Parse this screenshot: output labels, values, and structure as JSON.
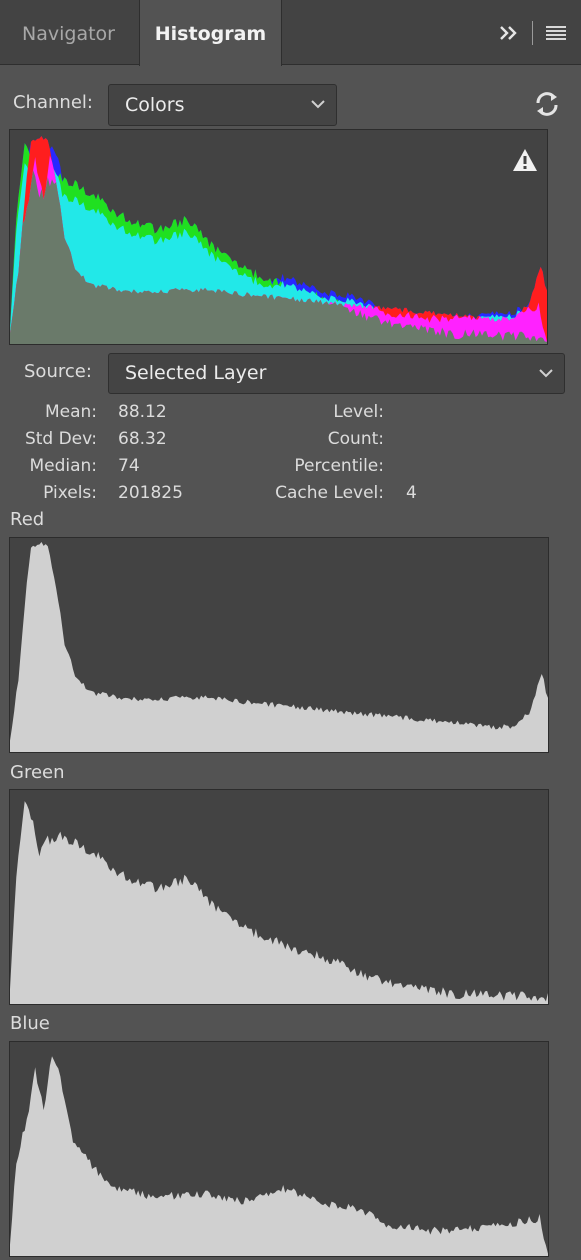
{
  "tabs": {
    "navigator": "Navigator",
    "histogram": "Histogram"
  },
  "icons": {
    "expand": "double-chevron-right-icon",
    "menu": "hamburger-menu-icon",
    "refresh": "refresh-icon",
    "warning": "warning-triangle-icon",
    "dropdown": "chevron-down-icon"
  },
  "channel": {
    "label": "Channel:",
    "value": "Colors"
  },
  "source": {
    "label": "Source:",
    "value": "Selected Layer"
  },
  "stats": {
    "mean_label": "Mean:",
    "mean": "88.12",
    "std_label": "Std Dev:",
    "std": "68.32",
    "median_label": "Median:",
    "median": "74",
    "pixels_label": "Pixels:",
    "pixels": "201825",
    "level_label": "Level:",
    "level": "",
    "count_label": "Count:",
    "count": "",
    "percentile_label": "Percentile:",
    "percentile": "",
    "cache_label": "Cache Level:",
    "cache": "4"
  },
  "channels": {
    "red": "Red",
    "green": "Green",
    "blue": "Blue"
  },
  "colors": {
    "panel_bg": "#535353",
    "plot_bg": "#434343",
    "histogram_fill": "#d0d0d0",
    "red": "#ff1e1e",
    "green": "#20e020",
    "blue": "#2828ff",
    "cyan": "#22e8e8",
    "magenta": "#ff22ff",
    "overlap": "#6a7a6a"
  }
}
